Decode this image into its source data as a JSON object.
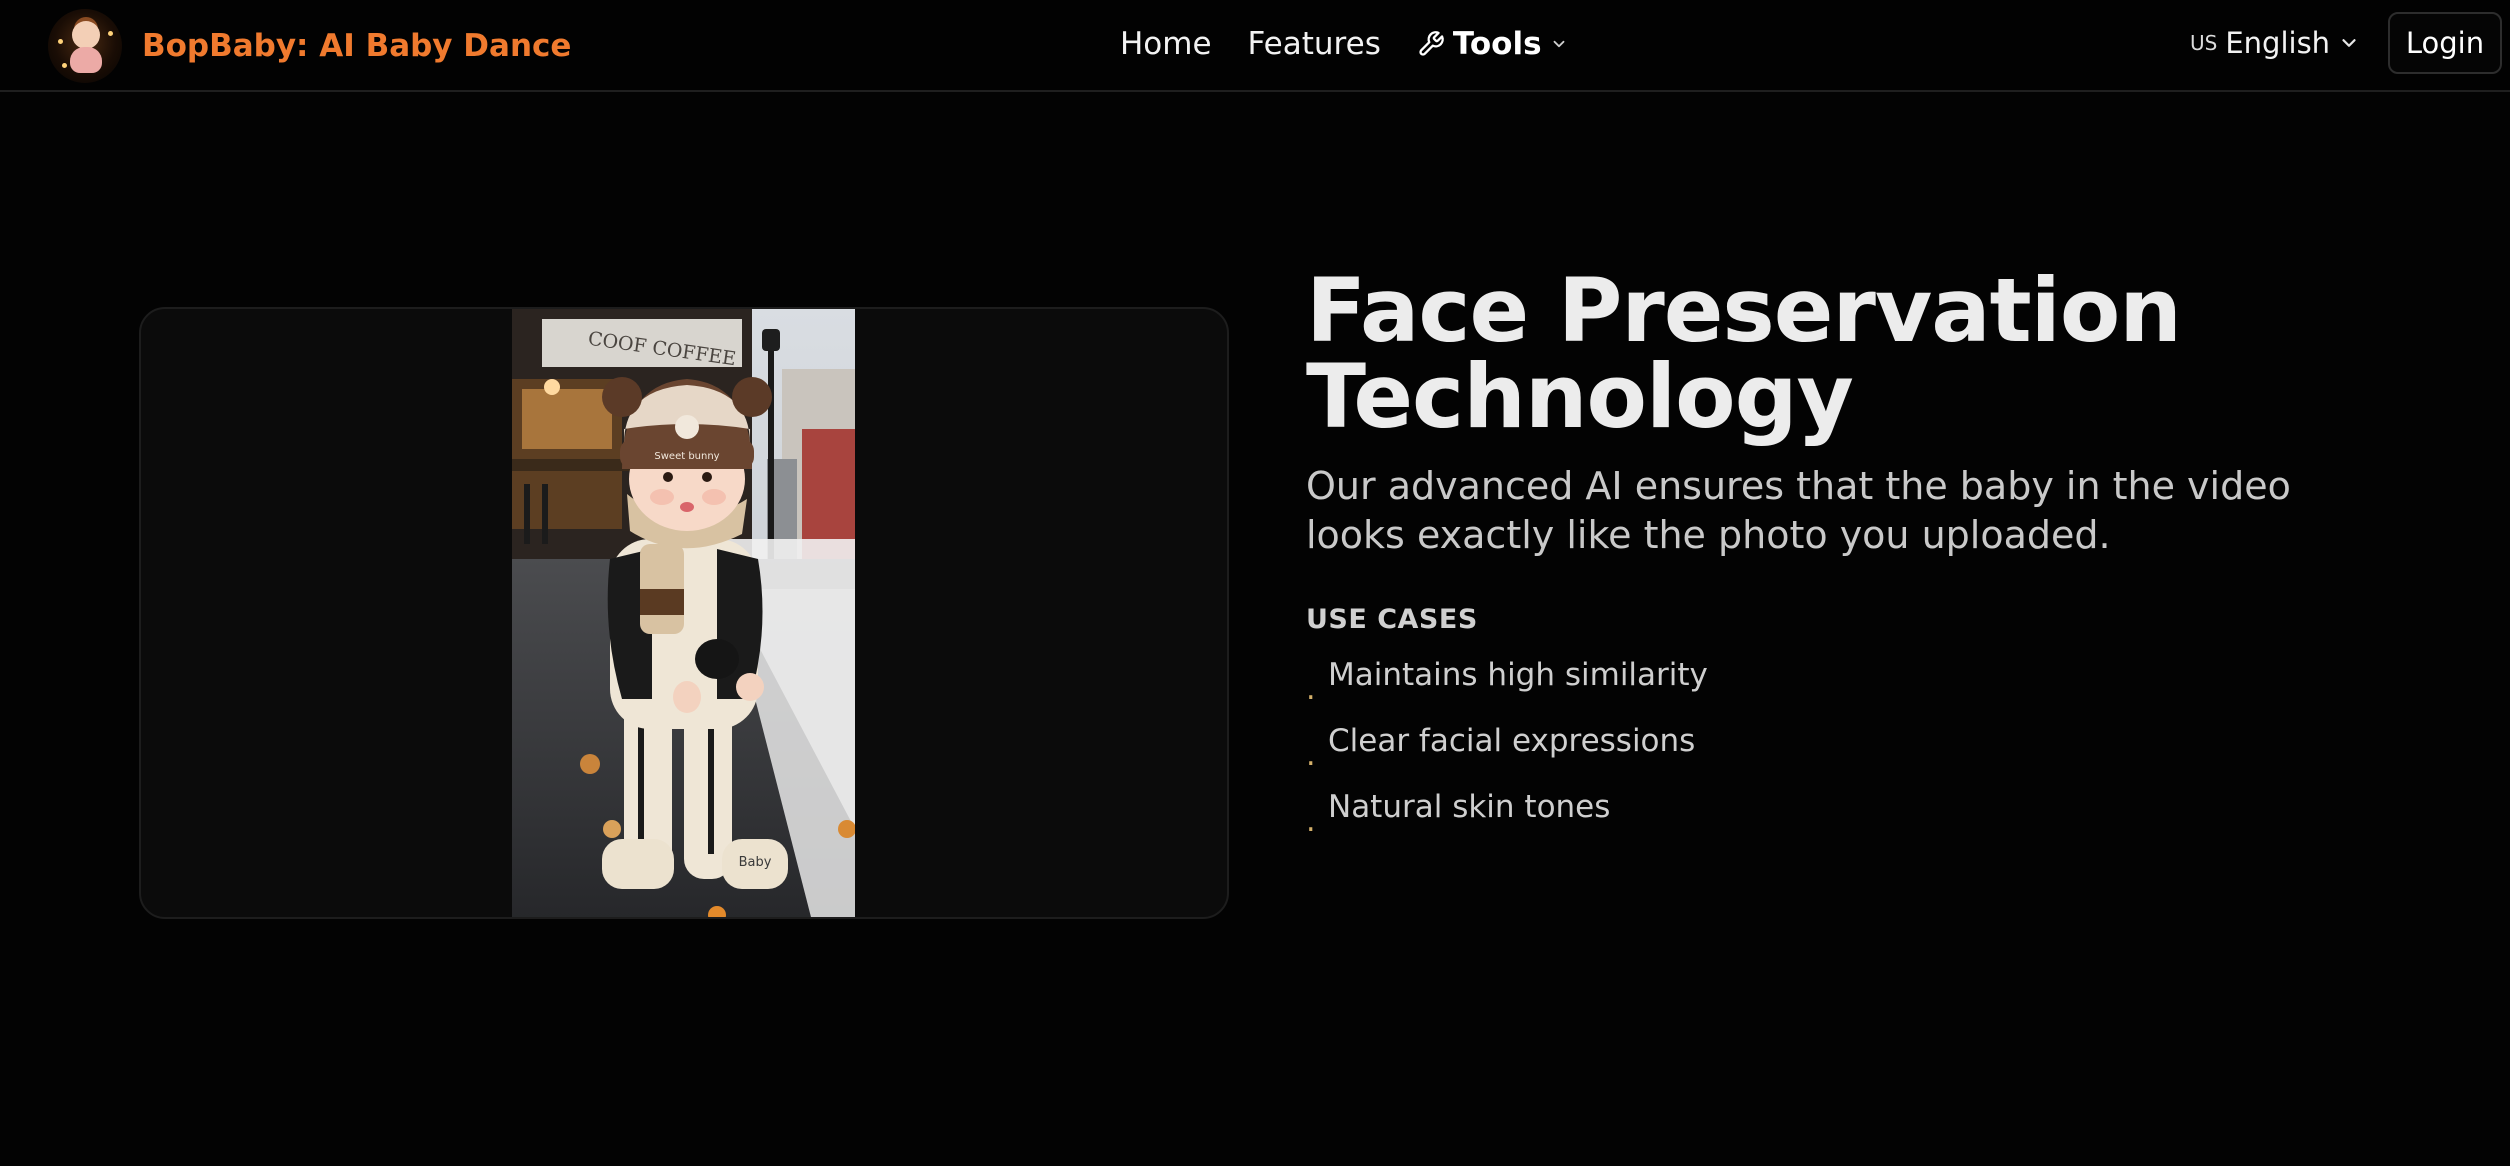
{
  "header": {
    "brand_name": "BopBaby: AI Baby Dance",
    "nav": {
      "home": "Home",
      "features": "Features",
      "tools": "Tools"
    },
    "language": {
      "flag_code": "US",
      "label": "English"
    },
    "login_label": "Login"
  },
  "section": {
    "title_line1": "Face Preservation",
    "title_line2": "Technology",
    "description": "Our advanced AI ensures that the baby in the video looks exactly like the photo you uploaded.",
    "use_cases_heading": "USE CASES",
    "use_cases": [
      "Maintains high similarity",
      "Clear facial expressions",
      "Natural skin tones"
    ],
    "bullet": "."
  },
  "photo": {
    "sign_text": "COOF COFFEE",
    "hat_text": "Sweet bunny",
    "shoe_text": "Baby"
  },
  "colors": {
    "brand_orange": "#f07a2e",
    "bullet_gold": "#d4b06a",
    "background": "#030303"
  }
}
